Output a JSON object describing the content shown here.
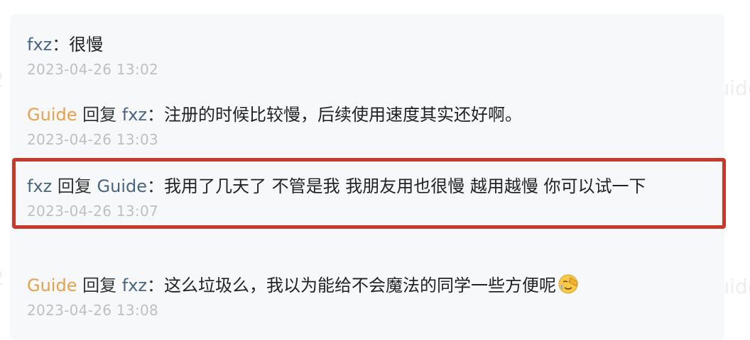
{
  "comments": [
    {
      "user": "fxz",
      "reply_word": "",
      "reply_to": "",
      "colon": "：",
      "text": "很慢",
      "time": "2023-04-26 13:02"
    },
    {
      "user": "Guide",
      "reply_word": "回复",
      "reply_to": "fxz",
      "colon": "：",
      "text": "注册的时候比较慢，后续使用速度其实还好啊。",
      "time": "2023-04-26 13:03"
    },
    {
      "user": "fxz",
      "reply_word": "回复",
      "reply_to": "Guide",
      "colon": "：",
      "text": "我用了几天了 不管是我 我朋友用也很慢 越用越慢 你可以试一下",
      "time": "2023-04-26 13:07"
    },
    {
      "user": "Guide",
      "reply_word": "回复",
      "reply_to": "fxz",
      "colon": "：",
      "text": "这么垃圾么，我以为能给不会魔法的同学一些方便呢",
      "emoji": "facepalm-emoji",
      "time": "2023-04-26 13:08"
    }
  ],
  "watermarks": {
    "left": "2",
    "right": "uide"
  },
  "colors": {
    "fxz": "#4a6584",
    "guide": "#e8a04c",
    "timestamp": "#bfbfbf",
    "highlight": "#c7392b",
    "panel": "#f7f8fa"
  }
}
